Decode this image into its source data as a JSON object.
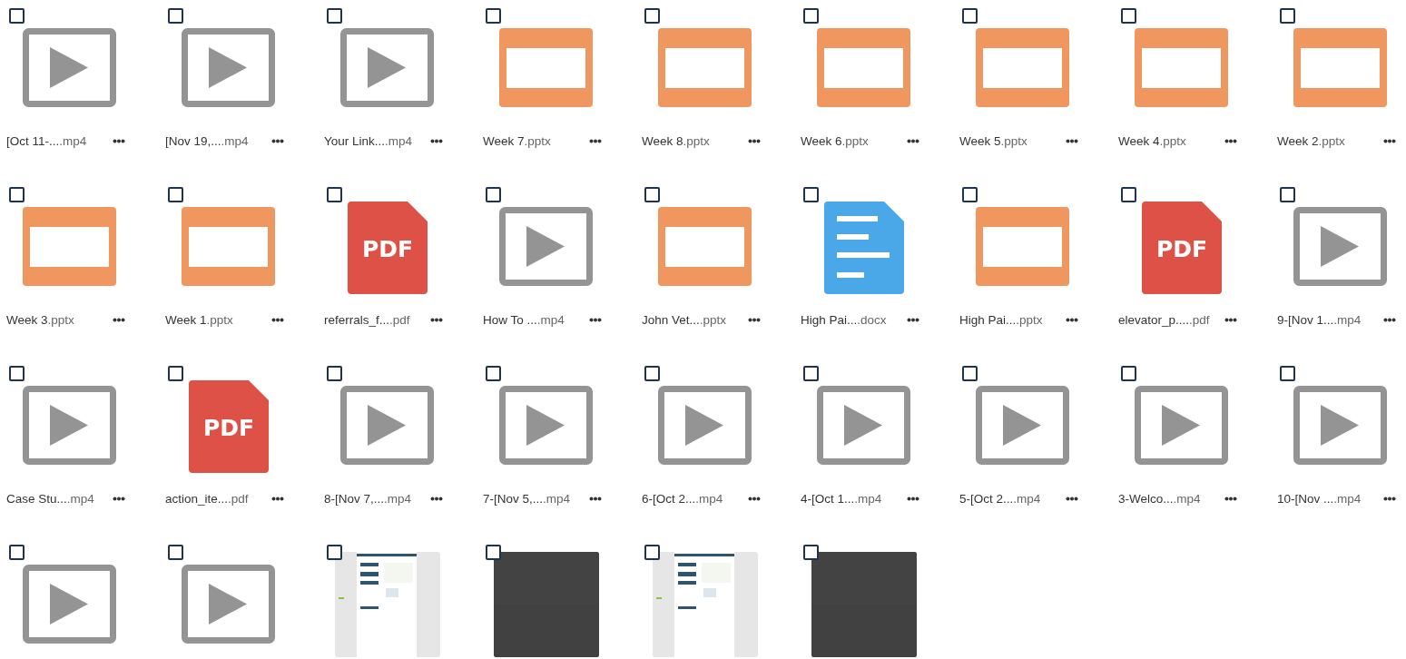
{
  "files": [
    {
      "kind": "video",
      "name": "[Oct 11-...",
      "ext": ".mp4",
      "checked": false
    },
    {
      "kind": "video",
      "name": "[Nov 19,...",
      "ext": ".mp4",
      "checked": false
    },
    {
      "kind": "video",
      "name": "Your Link...",
      "ext": ".mp4",
      "checked": false
    },
    {
      "kind": "slides",
      "name": "Week 7",
      "ext": ".pptx",
      "checked": false
    },
    {
      "kind": "slides",
      "name": "Week 8",
      "ext": ".pptx",
      "checked": false
    },
    {
      "kind": "slides",
      "name": "Week 6",
      "ext": ".pptx",
      "checked": false
    },
    {
      "kind": "slides",
      "name": "Week 5",
      "ext": ".pptx",
      "checked": false
    },
    {
      "kind": "slides",
      "name": "Week 4",
      "ext": ".pptx",
      "checked": false
    },
    {
      "kind": "slides",
      "name": "Week 2",
      "ext": ".pptx",
      "checked": false
    },
    {
      "kind": "slides",
      "name": "Week 3",
      "ext": ".pptx",
      "checked": false
    },
    {
      "kind": "slides",
      "name": "Week 1",
      "ext": ".pptx",
      "checked": false
    },
    {
      "kind": "pdf",
      "icon_text": "PDF",
      "name": "referrals_f...",
      "ext": ".pdf",
      "checked": false
    },
    {
      "kind": "video",
      "name": "How To ...",
      "ext": ".mp4",
      "checked": false
    },
    {
      "kind": "slides",
      "name": "John Vet...",
      "ext": ".pptx",
      "checked": false
    },
    {
      "kind": "doc",
      "name": "High Pai...",
      "ext": ".docx",
      "checked": false
    },
    {
      "kind": "slides",
      "name": "High Pai...",
      "ext": ".pptx",
      "checked": false
    },
    {
      "kind": "pdf",
      "icon_text": "PDF",
      "name": "elevator_p....",
      "ext": ".pdf",
      "checked": false
    },
    {
      "kind": "video",
      "name": "9-[Nov 1...",
      "ext": ".mp4",
      "checked": false
    },
    {
      "kind": "video",
      "name": "Case Stu...",
      "ext": ".mp4",
      "checked": false
    },
    {
      "kind": "pdf",
      "icon_text": "PDF",
      "name": "action_ite...",
      "ext": ".pdf",
      "checked": false
    },
    {
      "kind": "video",
      "name": "8-[Nov 7,...",
      "ext": ".mp4",
      "checked": false
    },
    {
      "kind": "video",
      "name": "7-[Nov 5,...",
      "ext": ".mp4",
      "checked": false
    },
    {
      "kind": "video",
      "name": "6-[Oct 2...",
      "ext": ".mp4",
      "checked": false
    },
    {
      "kind": "video",
      "name": "4-[Oct 1...",
      "ext": ".mp4",
      "checked": false
    },
    {
      "kind": "video",
      "name": "5-[Oct 2...",
      "ext": ".mp4",
      "checked": false
    },
    {
      "kind": "video",
      "name": "3-Welco...",
      "ext": ".mp4",
      "checked": false
    },
    {
      "kind": "video",
      "name": "10-[Nov ...",
      "ext": ".mp4",
      "checked": false
    },
    {
      "kind": "video",
      "checked": false
    },
    {
      "kind": "video",
      "checked": false
    },
    {
      "kind": "thumb_light",
      "checked": false
    },
    {
      "kind": "thumb_dark",
      "checked": false
    },
    {
      "kind": "thumb_light",
      "checked": false
    },
    {
      "kind": "thumb_dark",
      "checked": false
    }
  ]
}
